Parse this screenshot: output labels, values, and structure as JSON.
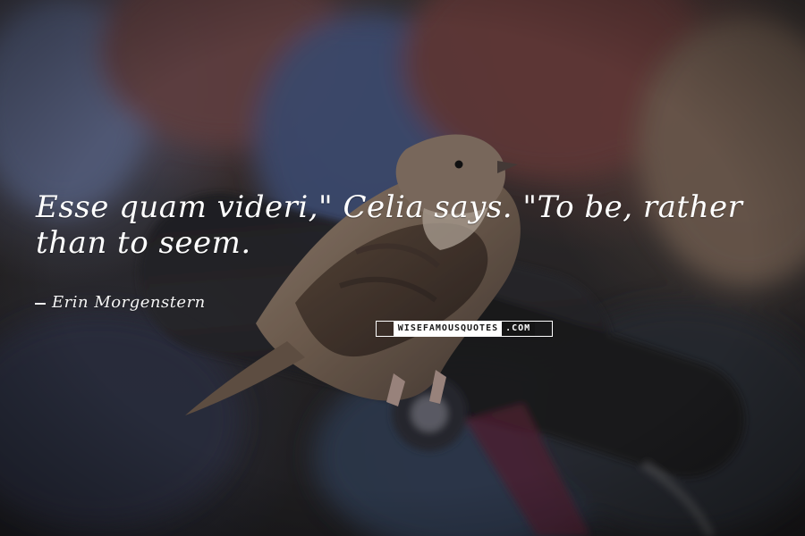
{
  "quote": {
    "text": "Esse quam videri,\" Celia says. \"To be, rather than to seem."
  },
  "author": {
    "name": "Erin Morgenstern"
  },
  "watermark": {
    "left_text": "WISEFAMOUSQUOTES",
    "right_text": ".COM"
  },
  "colors": {
    "background": "#2a2727",
    "text": "#ffffff",
    "watermark_dark": "#151515",
    "watermark_light": "#ffffff"
  },
  "icons": {
    "bird_image": "sparrow-photo"
  }
}
